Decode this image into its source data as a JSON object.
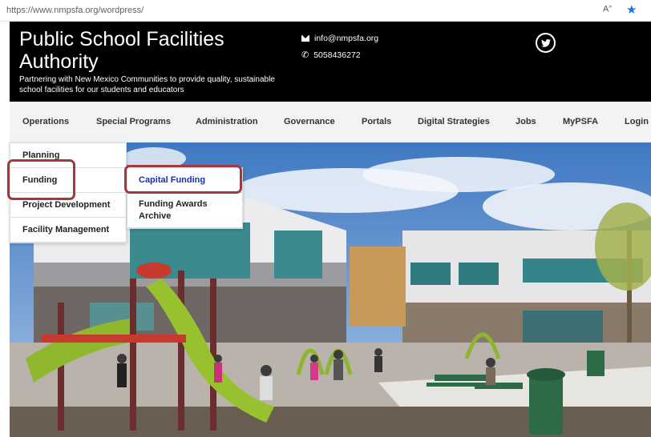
{
  "browser": {
    "url": "https://www.nmpsfa.org/wordpress/",
    "reader_label": "A",
    "reader_sup": "»"
  },
  "header": {
    "title": "Public School Facilities Authority",
    "tagline": "Partnering with New Mexico Communities to provide quality, sustainable school facilities for our students and educators",
    "email": "info@nmpsfa.org",
    "phone": "5058436272"
  },
  "nav": {
    "items": [
      "Operations",
      "Special Programs",
      "Administration",
      "Governance",
      "Portals",
      "Digital Strategies",
      "Jobs",
      "MyPSFA",
      "Login"
    ]
  },
  "dropdown": {
    "items": [
      "Planning",
      "Funding",
      "Project Development",
      "Facility Management"
    ]
  },
  "submenu": {
    "items": [
      "Capital Funding",
      "Funding Awards Archive"
    ]
  },
  "colors": {
    "header_bg": "#000000",
    "nav_bg": "#f3f3f3",
    "active_link": "#1a2fb0",
    "highlight": "#a33a3a"
  }
}
